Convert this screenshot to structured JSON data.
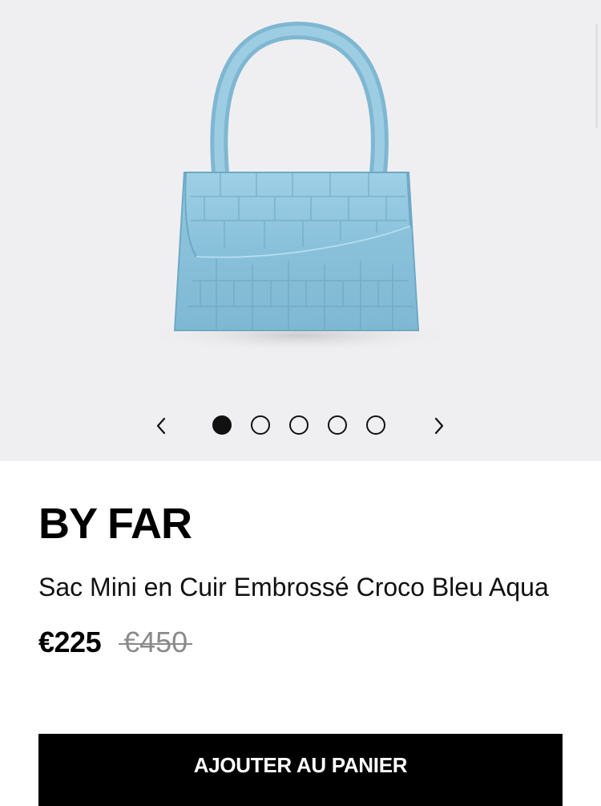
{
  "gallery": {
    "image_name": "blue-croc-mini-bag",
    "bag_color": "#8ec3dc",
    "background_color": "#efeff1",
    "prev_icon": "chevron-left-icon",
    "next_icon": "chevron-right-icon",
    "slide_count": 5,
    "active_slide": 1
  },
  "product": {
    "brand": "BY FAR",
    "name": "Sac Mini en Cuir Embrossé Croco Bleu Aqua",
    "price": "€225",
    "old_price": "€450"
  },
  "actions": {
    "add_to_cart_label": "AJOUTER AU PANIER"
  }
}
